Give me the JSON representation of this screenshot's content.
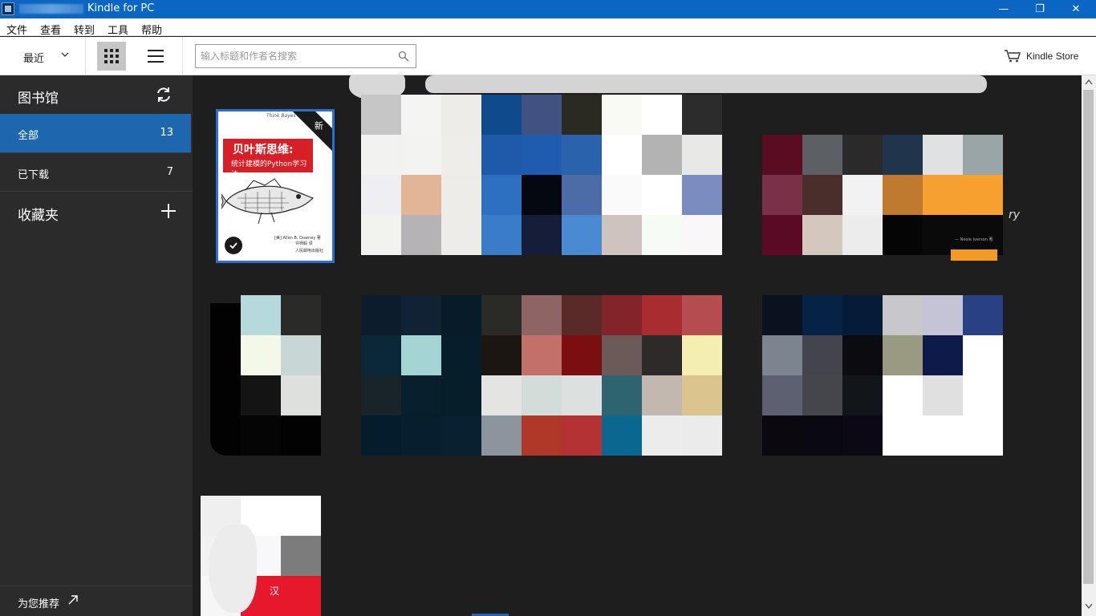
{
  "window": {
    "title": "Kindle for PC",
    "controls": {
      "minimize": "—",
      "restore": "❐",
      "close": "✕"
    }
  },
  "menu": {
    "items": [
      "文件",
      "查看",
      "转到",
      "工具",
      "帮助"
    ]
  },
  "toolbar": {
    "sort_label": "最近",
    "search_placeholder": "输入标题和作者名搜索",
    "search_value": "",
    "store_label": "Kindle Store"
  },
  "sidebar": {
    "library_title": "图书馆",
    "items": [
      {
        "label": "全部",
        "count": "13"
      },
      {
        "label": "已下载",
        "count": "7"
      }
    ],
    "collections_title": "收藏夹",
    "recommend_label": "为您推荐"
  },
  "book_featured": {
    "series": "Think Bayes",
    "new_badge": "新",
    "title": "贝叶斯思维:",
    "subtitle": "统计建模的Python学习法",
    "author": "[美] Allen B. Downey 著",
    "translator": "许杨毅 译",
    "publisher": "人民邮电出版社"
  },
  "book_fragments": {
    "cover_right_text": "ry",
    "cover_right_author": "— Neale Iverson 著",
    "cover_bottom_text": "汉"
  },
  "colors": {
    "titlebar": "#0a66c2",
    "sidebar": "#2b2b2b",
    "sidebar_active": "#1e66ad",
    "main_bg": "#1e1e1e",
    "selection": "#2a6fcf"
  }
}
